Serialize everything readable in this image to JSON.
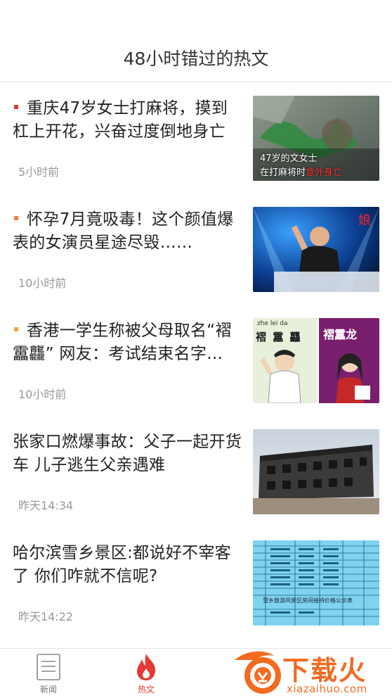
{
  "header": {
    "title": "48小时错过的热文"
  },
  "news": [
    {
      "headline": "重庆47岁女士打麻将，摸到杠上开花，兴奋过度倒地身亡",
      "time": "5小时前",
      "thumb_caption_line1": "47岁的文女士",
      "thumb_caption_line2a": "在打麻将时",
      "thumb_caption_line2b": "意外身亡",
      "dot_color": "#e53935"
    },
    {
      "headline": "怀孕7月竟吸毒！这个颜值爆表的女演员星途尽毁……",
      "time": "10小时前",
      "dot_color": "#f57c3c"
    },
    {
      "headline": "香港一学生称被父母取名“褶靁龘” 网友：考试结束名字…",
      "time": "10小时前",
      "thumb_chars": "褶 靁 龘",
      "thumb_pinyin": "zhe   lei   da",
      "thumb_right_label": "褶靁龙",
      "dot_color": "#f5a23c"
    },
    {
      "headline": "张家口燃爆事故：父子一起开货车 儿子逃生父亲遇难",
      "time": "昨天14:34"
    },
    {
      "headline": "哈尔滨雪乡景区:都说好不宰客了 你们咋就不信呢?",
      "time": "昨天14:22",
      "thumb_table_title": "雪乡旅游风景区房间接待价格公示表"
    }
  ],
  "tabbar": {
    "tabs": [
      {
        "label": "新闻",
        "icon": "news-icon"
      },
      {
        "label": "热文",
        "icon": "fire-icon"
      }
    ]
  },
  "watermark": {
    "brand": "下载火",
    "url": "xiazaihuo.com"
  },
  "colors": {
    "accent": "#e53935",
    "watermark_orange": "#f26b21"
  }
}
